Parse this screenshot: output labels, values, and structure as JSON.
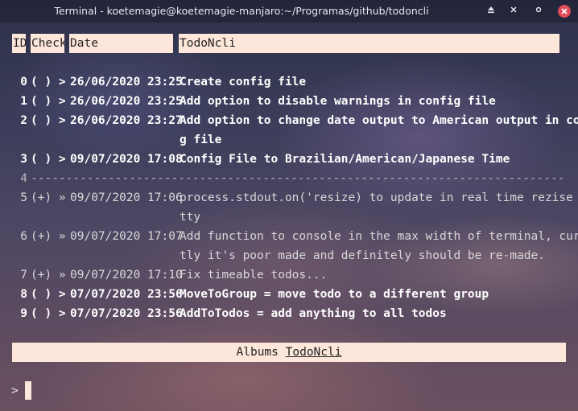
{
  "window": {
    "title": "Terminal - koetemagie@koetemagie-manjaro:~/Programas/github/todoncli",
    "buttons": {
      "keep_above": "⏏",
      "minimize": "✕",
      "maximize": "⁰",
      "close": "✕"
    }
  },
  "header": {
    "id": "ID",
    "check": "Check",
    "date": "Date",
    "todo": "TodoNcli"
  },
  "rows": [
    {
      "id": "0",
      "check": "( ) >",
      "date": "26/06/2020 23:25",
      "text": "Create config file",
      "state": "pending"
    },
    {
      "id": "1",
      "check": "( ) >",
      "date": "26/06/2020 23:25",
      "text": "Add option to disable warnings in config file",
      "state": "pending"
    },
    {
      "id": "2",
      "check": "( ) >",
      "date": "26/06/2020 23:27",
      "text": "Add option to change date output to American output in confi",
      "text_cont": "g file",
      "state": "pending"
    },
    {
      "id": "3",
      "check": "( ) >",
      "date": "09/07/2020 17:08",
      "text": "Config File to Brazilian/American/Japanese Time",
      "state": "pending"
    },
    {
      "id": "4",
      "separator": "---------------------------------------------------------------------------------------"
    },
    {
      "id": "5",
      "check": "(+) »",
      "date": "09/07/2020 17:06",
      "text": "process.stdout.on('resize) to update in real time rezise of",
      "text_cont": "tty",
      "state": "done"
    },
    {
      "id": "6",
      "check": "(+) »",
      "date": "09/07/2020 17:07",
      "text": "Add function to console in the max width of terminal, curren",
      "text_cont": "tly it's poor made and definitely should be re-made.",
      "state": "done"
    },
    {
      "id": "7",
      "check": "(+) »",
      "date": "09/07/2020 17:10",
      "text": "Fix timeable todos...",
      "state": "done"
    },
    {
      "id": "8",
      "check": "( ) >",
      "date": "07/07/2020 23:56",
      "text": "MoveToGroup = move todo to a different group",
      "state": "pending"
    },
    {
      "id": "9",
      "check": "( ) >",
      "date": "07/07/2020 23:56",
      "text": "AddToTodos = add anything to all todos",
      "state": "pending"
    }
  ],
  "footer": {
    "groups": [
      "Albums",
      "TodoNcli"
    ],
    "active_group": "TodoNcli"
  },
  "prompt": {
    "symbol": ">",
    "input": ""
  },
  "colors": {
    "header_bg": "#fde6da",
    "close_button": "#e24a5a"
  }
}
